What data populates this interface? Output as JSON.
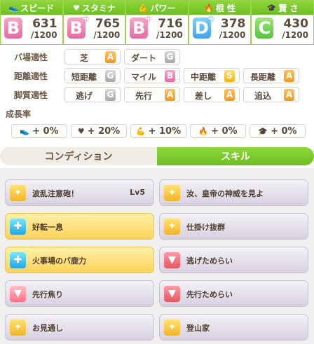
{
  "stats": [
    {
      "label": "スピード",
      "icon": "shoe-icon",
      "grade": "B",
      "plus": false,
      "value": "631",
      "max": "/1200"
    },
    {
      "label": "スタミナ",
      "icon": "heart-icon",
      "grade": "B",
      "plus": true,
      "value": "765",
      "max": "/1200"
    },
    {
      "label": "パワー",
      "icon": "muscle-icon",
      "grade": "B",
      "plus": true,
      "value": "716",
      "max": "/1200"
    },
    {
      "label": "根 性",
      "icon": "flame-icon",
      "grade": "D",
      "plus": true,
      "value": "378",
      "max": "/1200"
    },
    {
      "label": "賢 さ",
      "icon": "graduation-cap-icon",
      "grade": "C",
      "plus": false,
      "value": "430",
      "max": "/1200"
    }
  ],
  "aptitude": {
    "track": {
      "label": "バ場適性",
      "items": [
        {
          "name": "芝",
          "grade": "A"
        },
        {
          "name": "ダート",
          "grade": "G"
        }
      ]
    },
    "distance": {
      "label": "距離適性",
      "items": [
        {
          "name": "短距離",
          "grade": "G"
        },
        {
          "name": "マイル",
          "grade": "B"
        },
        {
          "name": "中距離",
          "grade": "S"
        },
        {
          "name": "長距離",
          "grade": "A"
        }
      ]
    },
    "style": {
      "label": "脚質適性",
      "items": [
        {
          "name": "逃げ",
          "grade": "G"
        },
        {
          "name": "先行",
          "grade": "A"
        },
        {
          "name": "差し",
          "grade": "A"
        },
        {
          "name": "追込",
          "grade": "A"
        }
      ]
    }
  },
  "growth": {
    "title": "成長率",
    "items": [
      {
        "icon": "shoe-icon",
        "glyph": "👟",
        "value": "+ 0%"
      },
      {
        "icon": "heart-icon",
        "glyph": "♥",
        "value": "+ 20%"
      },
      {
        "icon": "muscle-icon",
        "glyph": "💪",
        "value": "+ 10%"
      },
      {
        "icon": "flame-icon",
        "glyph": "🔥",
        "value": "+ 0%"
      },
      {
        "icon": "graduation-cap-icon",
        "glyph": "🎓",
        "value": "+ 0%"
      }
    ]
  },
  "tabs": {
    "condition": "コンディション",
    "skill": "スキル"
  },
  "skills": [
    {
      "name": "波乱注意砲！",
      "level": "Lv5",
      "icon": "speed-burst-icon",
      "color": "yellow",
      "gold": false
    },
    {
      "name": "汝、皇帝の神威を見よ",
      "level": "",
      "icon": "speed-burst-icon",
      "color": "yellow",
      "gold": false
    },
    {
      "name": "好転一息",
      "level": "",
      "icon": "recovery-icon",
      "color": "blue",
      "gold": true
    },
    {
      "name": "仕掛け抜群",
      "level": "",
      "icon": "speed-burst-icon",
      "color": "yellow",
      "gold": false
    },
    {
      "name": "火事場のバ鹿力",
      "level": "",
      "icon": "recovery-icon",
      "color": "blue",
      "gold": true
    },
    {
      "name": "逃げためらい",
      "level": "",
      "icon": "debuff-icon",
      "color": "red",
      "gold": false
    },
    {
      "name": "先行焦り",
      "level": "",
      "icon": "debuff-icon",
      "color": "flame",
      "gold": false
    },
    {
      "name": "先行ためらい",
      "level": "",
      "icon": "debuff-icon",
      "color": "red",
      "gold": false
    },
    {
      "name": "お見通し",
      "level": "",
      "icon": "speed-burst-icon",
      "color": "yellow",
      "gold": false
    },
    {
      "name": "登山家",
      "level": "",
      "icon": "speed-burst-icon",
      "color": "yellow",
      "gold": false
    }
  ]
}
